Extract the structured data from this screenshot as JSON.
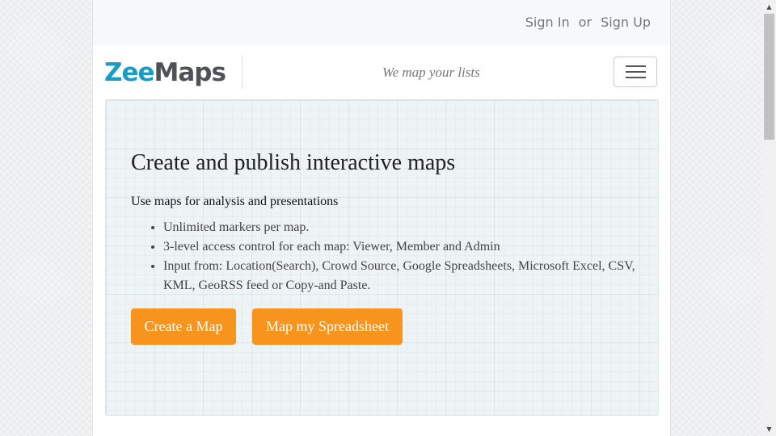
{
  "auth": {
    "sign_in": "Sign In",
    "separator": "or",
    "sign_up": "Sign Up"
  },
  "brand": {
    "name_part1": "Zee",
    "name_part2": "Maps",
    "tagline": "We map your lists",
    "colors": {
      "primary": "#1a9cc4",
      "secondary": "#4d5256"
    }
  },
  "nav": {
    "menu_icon": "hamburger-icon"
  },
  "hero": {
    "title": "Create and publish interactive maps",
    "subtitle": "Use maps for analysis and presentations",
    "features": [
      "Unlimited markers per map.",
      "3-level access control for each map: Viewer, Member and Admin",
      "Input from: Location(Search), Crowd Source, Google Spreadsheets, Microsoft Excel, CSV, KML, GeoRSS feed or Copy-and Paste."
    ],
    "buttons": {
      "create_map": "Create a Map",
      "map_spreadsheet": "Map my Spreadsheet"
    },
    "button_color": "#f7941e"
  },
  "scrollbar": {
    "up_icon": "▲",
    "down_icon": "▼"
  }
}
